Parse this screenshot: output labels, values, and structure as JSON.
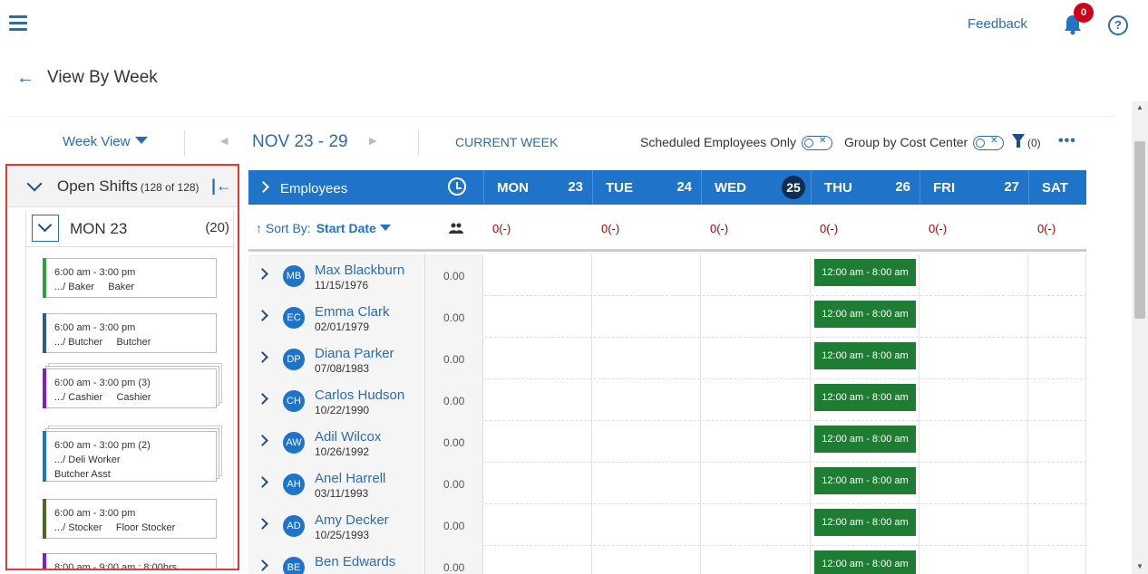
{
  "header": {
    "feedback_label": "Feedback",
    "notification_count": "0",
    "help_label": "?"
  },
  "page": {
    "title": "View By Week"
  },
  "toolbar": {
    "view_label": "Week View",
    "date_range": "NOV 23 - 29",
    "current_week_label": "CURRENT WEEK",
    "scheduled_only_label": "Scheduled Employees Only",
    "group_by_label": "Group by Cost Center",
    "filter_count": "(0)",
    "more_label": "•••"
  },
  "open_shifts": {
    "title": "Open Shifts",
    "count": "(128 of 128)",
    "day_label": "MON 23",
    "day_count": "(20)",
    "cards": [
      {
        "time": "6:00 am - 3:00 pm",
        "detail": ".../ Baker     Baker",
        "detail2": "",
        "color": "#2e9e3e",
        "stacked": false
      },
      {
        "time": "6:00 am - 3:00 pm",
        "detail": ".../ Butcher     Butcher",
        "detail2": "",
        "color": "#2b5f8a",
        "stacked": false
      },
      {
        "time": "6:00 am - 3:00 pm (3)",
        "detail": ".../ Cashier     Cashier",
        "detail2": "",
        "color": "#7b1fd1",
        "stacked": true
      },
      {
        "time": "6:00 am - 3:00 pm (2)",
        "detail": ".../ Deli Worker",
        "detail2": "Butcher Asst",
        "color": "#1f73c8",
        "stacked": true
      },
      {
        "time": "6:00 am - 3:00 pm",
        "detail": ".../ Stocker     Floor Stocker",
        "detail2": "",
        "color": "#4a6b1a",
        "stacked": false
      },
      {
        "time": "8:00 am - 9:00 am : 8:00hrs",
        "detail": "",
        "detail2": "",
        "color": "#7b1fd1",
        "stacked": false
      }
    ]
  },
  "grid": {
    "employees_label": "Employees",
    "sort_prefix": "Sort By:",
    "sort_value": "Start Date",
    "days": [
      {
        "name": "MON",
        "date": "23",
        "total": "0(-)",
        "today": false
      },
      {
        "name": "TUE",
        "date": "24",
        "total": "0(-)",
        "today": false
      },
      {
        "name": "WED",
        "date": "25",
        "total": "0(-)",
        "today": true
      },
      {
        "name": "THU",
        "date": "26",
        "total": "0(-)",
        "today": false
      },
      {
        "name": "FRI",
        "date": "27",
        "total": "0(-)",
        "today": false
      },
      {
        "name": "SAT",
        "date": "",
        "total": "0(-)",
        "today": false
      }
    ],
    "employees": [
      {
        "initials": "MB",
        "name": "Max Blackburn",
        "date": "11/15/1976",
        "hours": "0.00",
        "thu_shift": "12:00 am - 8:00 am"
      },
      {
        "initials": "EC",
        "name": "Emma Clark",
        "date": "02/01/1979",
        "hours": "0.00",
        "thu_shift": "12:00 am - 8:00 am"
      },
      {
        "initials": "DP",
        "name": "Diana Parker",
        "date": "07/08/1983",
        "hours": "0.00",
        "thu_shift": "12:00 am - 8:00 am"
      },
      {
        "initials": "CH",
        "name": "Carlos Hudson",
        "date": "10/22/1990",
        "hours": "0.00",
        "thu_shift": "12:00 am - 8:00 am"
      },
      {
        "initials": "AW",
        "name": "Adil Wilcox",
        "date": "10/26/1992",
        "hours": "0.00",
        "thu_shift": "12:00 am - 8:00 am"
      },
      {
        "initials": "AH",
        "name": "Anel Harrell",
        "date": "03/11/1993",
        "hours": "0.00",
        "thu_shift": "12:00 am - 8:00 am"
      },
      {
        "initials": "AD",
        "name": "Amy Decker",
        "date": "10/25/1993",
        "hours": "0.00",
        "thu_shift": "12:00 am - 8:00 am"
      },
      {
        "initials": "BE",
        "name": "Ben Edwards",
        "date": "",
        "hours": "0.00",
        "thu_shift": "12:00 am - 8:00 am"
      }
    ]
  },
  "colors": {
    "accent": "#1f73c8",
    "shift_green": "#1e7d32",
    "highlight_border": "#e53935"
  }
}
